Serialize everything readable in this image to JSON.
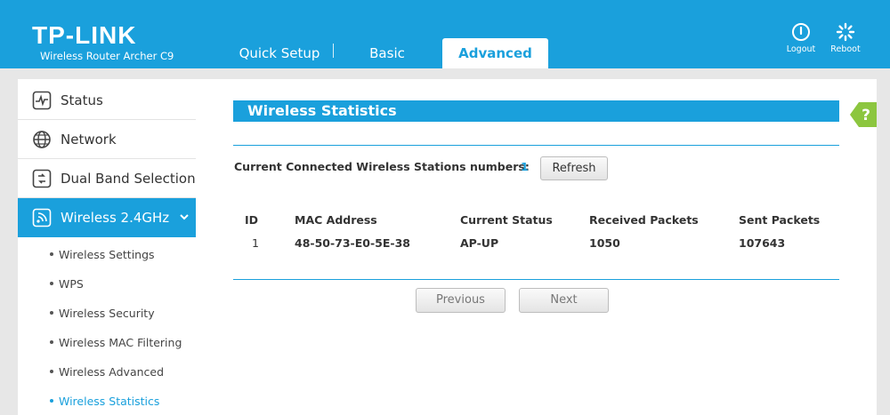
{
  "header": {
    "brand": "TP-LINK",
    "model": "Wireless Router Archer C9",
    "tabs": [
      "Quick Setup",
      "Basic",
      "Advanced"
    ],
    "logout_label": "Logout",
    "reboot_label": "Reboot",
    "accent": "#1aa0dc"
  },
  "sidebar": {
    "items": [
      {
        "label": "Status",
        "icon": "status-icon"
      },
      {
        "label": "Network",
        "icon": "globe-icon"
      },
      {
        "label": "Dual Band Selection",
        "icon": "dual-band-icon"
      },
      {
        "label": "Wireless 2.4GHz",
        "icon": "wireless-icon"
      }
    ],
    "subitems": [
      "Wireless Settings",
      "WPS",
      "Wireless Security",
      "Wireless MAC Filtering",
      "Wireless Advanced",
      "Wireless Statistics"
    ]
  },
  "main": {
    "title": "Wireless Statistics",
    "connected_label": "Current Connected Wireless Stations numbers:",
    "connected_count": "1",
    "refresh_label": "Refresh",
    "columns": [
      "ID",
      "MAC Address",
      "Current Status",
      "Received Packets",
      "Sent Packets"
    ],
    "rows": [
      [
        "1",
        "48-50-73-E0-5E-38",
        "AP-UP",
        "1050",
        "107643"
      ]
    ],
    "previous_label": "Previous",
    "next_label": "Next",
    "help_label": "?"
  }
}
